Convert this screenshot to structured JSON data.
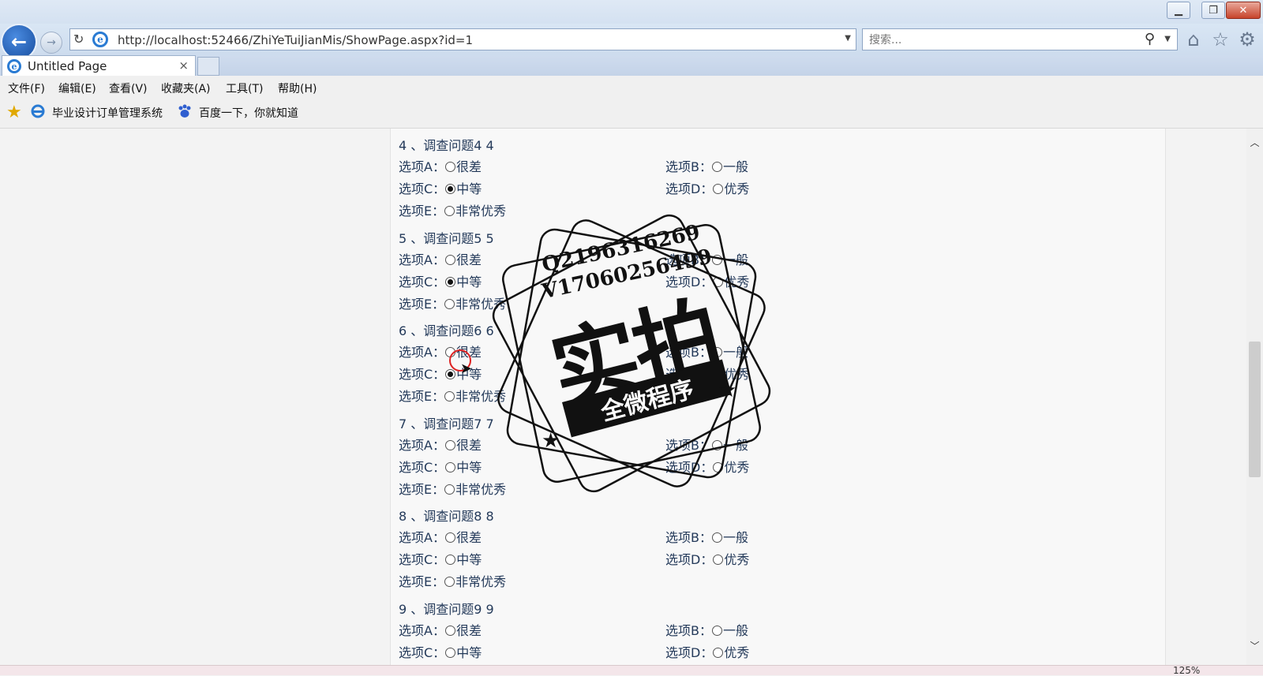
{
  "browser": {
    "url": "http://localhost:52466/ZhiYeTuiJianMis/ShowPage.aspx?id=1",
    "search_placeholder": "搜索...",
    "tab_title": "Untitled Page",
    "tab_close": "×",
    "menu": [
      "文件(F)",
      "编辑(E)",
      "查看(V)",
      "收藏夹(A)",
      "工具(T)",
      "帮助(H)"
    ],
    "favorites": [
      "毕业设计订单管理系统",
      "百度一下，你就知道"
    ],
    "zoom": "125%"
  },
  "questions": [
    {
      "title": "4 、调查问题4 4",
      "options": [
        {
          "label": "选项A：",
          "text": "很差",
          "checked": false
        },
        {
          "label": "选项B：",
          "text": "一般",
          "checked": false
        },
        {
          "label": "选项C：",
          "text": "中等",
          "checked": true
        },
        {
          "label": "选项D：",
          "text": "优秀",
          "checked": false
        },
        {
          "label": "选项E：",
          "text": "非常优秀",
          "checked": false
        }
      ]
    },
    {
      "title": "5 、调查问题5 5",
      "options": [
        {
          "label": "选项A：",
          "text": "很差",
          "checked": false
        },
        {
          "label": "选项B：",
          "text": "一般",
          "checked": false
        },
        {
          "label": "选项C：",
          "text": "中等",
          "checked": true
        },
        {
          "label": "选项D：",
          "text": "优秀",
          "checked": false
        },
        {
          "label": "选项E：",
          "text": "非常优秀",
          "checked": false
        }
      ]
    },
    {
      "title": "6 、调查问题6 6",
      "options": [
        {
          "label": "选项A：",
          "text": "很差",
          "checked": false
        },
        {
          "label": "选项B：",
          "text": "一般",
          "checked": false
        },
        {
          "label": "选项C：",
          "text": "中等",
          "checked": true
        },
        {
          "label": "选项D：",
          "text": "优秀",
          "checked": false
        },
        {
          "label": "选项E：",
          "text": "非常优秀",
          "checked": false
        }
      ]
    },
    {
      "title": "7 、调查问题7 7",
      "options": [
        {
          "label": "选项A：",
          "text": "很差",
          "checked": false
        },
        {
          "label": "选项B：",
          "text": "一般",
          "checked": false
        },
        {
          "label": "选项C：",
          "text": "中等",
          "checked": false
        },
        {
          "label": "选项D：",
          "text": "优秀",
          "checked": false
        },
        {
          "label": "选项E：",
          "text": "非常优秀",
          "checked": false
        }
      ]
    },
    {
      "title": "8 、调查问题8 8",
      "options": [
        {
          "label": "选项A：",
          "text": "很差",
          "checked": false
        },
        {
          "label": "选项B：",
          "text": "一般",
          "checked": false
        },
        {
          "label": "选项C：",
          "text": "中等",
          "checked": false
        },
        {
          "label": "选项D：",
          "text": "优秀",
          "checked": false
        },
        {
          "label": "选项E：",
          "text": "非常优秀",
          "checked": false
        }
      ]
    },
    {
      "title": "9 、调查问题9 9",
      "options": [
        {
          "label": "选项A：",
          "text": "很差",
          "checked": false
        },
        {
          "label": "选项B：",
          "text": "一般",
          "checked": false
        },
        {
          "label": "选项C：",
          "text": "中等",
          "checked": false
        },
        {
          "label": "选项D：",
          "text": "优秀",
          "checked": false
        }
      ]
    }
  ],
  "watermark": {
    "line1": "Q2196316269",
    "line2": "V17060256499",
    "main": "实拍",
    "ribbon": "全微程序"
  }
}
